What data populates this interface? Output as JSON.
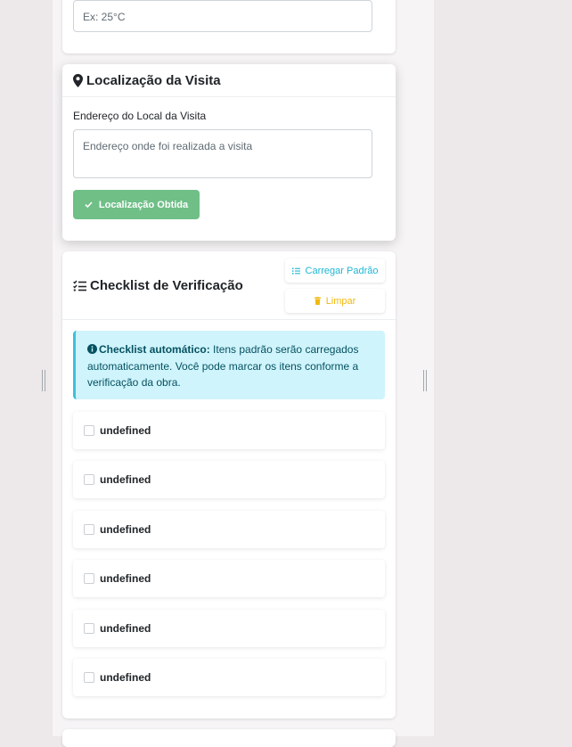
{
  "temperature": {
    "placeholder": "Ex: 25°C"
  },
  "location": {
    "title": "Localização da Visita",
    "address_label": "Endereço do Local da Visita",
    "address_placeholder": "Endereço onde foi realizada a visita",
    "location_button": "Localização Obtida"
  },
  "checklist": {
    "title": "Checklist de Verificação",
    "load_default_button": "Carregar Padrão",
    "clear_button": "Limpar",
    "alert_bold": "Checklist automático:",
    "alert_text": " Itens padrão serão carregados automaticamente. Você pode marcar os itens conforme a verificação da obra.",
    "items": [
      "undefined",
      "undefined",
      "undefined",
      "undefined",
      "undefined",
      "undefined"
    ]
  },
  "colors": {
    "success": "#6fbf87",
    "info": "#1fb6d4",
    "warning": "#f2b90f",
    "alert_bg": "#cff4fc"
  }
}
